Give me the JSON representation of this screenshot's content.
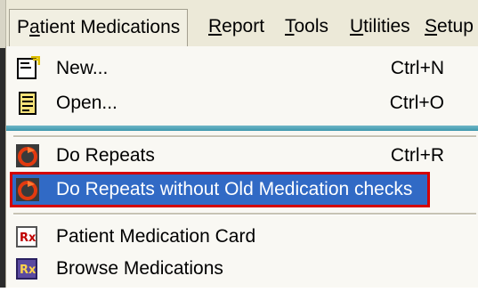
{
  "menubar": {
    "items": [
      {
        "label": "Patient Medications",
        "mnemonic_before": "P",
        "mnemonic": "a",
        "mnemonic_after": "tient Medications"
      },
      {
        "label": "Report",
        "mnemonic_before": "",
        "mnemonic": "R",
        "mnemonic_after": "eport"
      },
      {
        "label": "Tools",
        "mnemonic_before": "",
        "mnemonic": "T",
        "mnemonic_after": "ools"
      },
      {
        "label": "Utilities",
        "mnemonic_before": "",
        "mnemonic": "U",
        "mnemonic_after": "tilities"
      },
      {
        "label": "Setup",
        "mnemonic_before": "",
        "mnemonic": "S",
        "mnemonic_after": "etup"
      }
    ]
  },
  "menu": {
    "items": [
      {
        "label": "New...",
        "shortcut": "Ctrl+N",
        "icon": "new-document-icon"
      },
      {
        "label": "Open...",
        "shortcut": "Ctrl+O",
        "icon": "open-document-icon"
      },
      {
        "label": "Do Repeats",
        "shortcut": "Ctrl+R",
        "icon": "repeat-icon"
      },
      {
        "label": "Do Repeats without Old Medication checks",
        "shortcut": "",
        "icon": "repeat-icon",
        "highlighted": true
      },
      {
        "label": "Patient Medication Card",
        "shortcut": "",
        "icon": "rx-card-icon"
      },
      {
        "label": "Browse Medications",
        "shortcut": "",
        "icon": "browse-rx-icon"
      }
    ]
  },
  "colors": {
    "highlight_bg": "#316ac5",
    "highlight_outline": "#d40000",
    "menubar_bg": "#ece9d8"
  }
}
